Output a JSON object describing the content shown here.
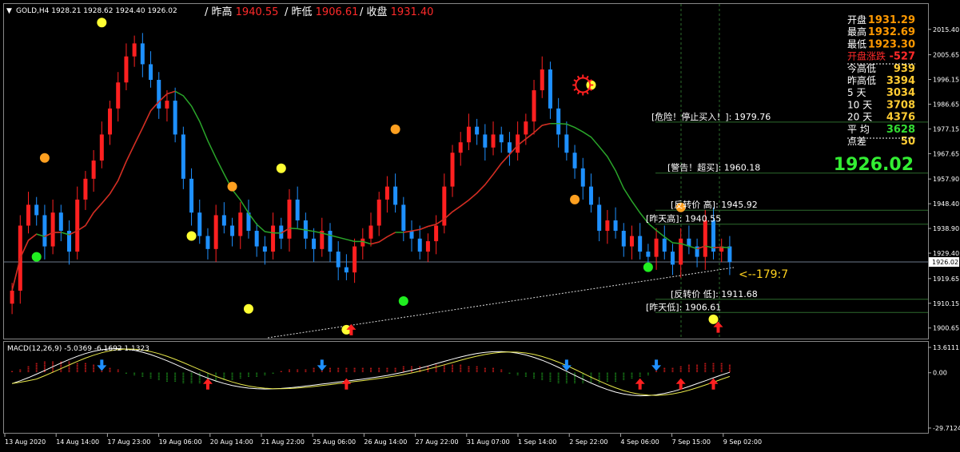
{
  "symbol_header": "GOLD,H4  1928.21 1928.62 1924.40 1926.02",
  "top_info": [
    {
      "label": "/ 昨高 ",
      "value": "1940.55"
    },
    {
      "label": "/ 昨低 ",
      "value": "1906.61"
    },
    {
      "label": "/ 收盘 ",
      "value": "1931.40"
    }
  ],
  "stats": [
    {
      "label": "开盘",
      "value": "1931.29",
      "color": "#ff9900"
    },
    {
      "label": "最高",
      "value": "1932.69",
      "color": "#ff9900"
    },
    {
      "label": "最低",
      "value": "1923.30",
      "color": "#ff9900"
    },
    {
      "label": "开盘涨跌",
      "value": "-527",
      "color": "#ff2a2a"
    },
    {
      "label": "今高低",
      "value": "939",
      "color": "#ffcc33"
    },
    {
      "label": "昨高低",
      "value": "3394",
      "color": "#ffcc33"
    },
    {
      "label": "5  天",
      "value": "3034",
      "color": "#ffcc33"
    },
    {
      "label": "10 天",
      "value": "3708",
      "color": "#ffcc33"
    },
    {
      "label": "20 天",
      "value": "4376",
      "color": "#ffcc33"
    },
    {
      "label": "平  均",
      "value": "3628",
      "color": "#33dd33"
    },
    {
      "label": "点差",
      "value": "50",
      "color": "#ffcc33"
    }
  ],
  "big_price": "1926.02",
  "level_labels": [
    {
      "text": "[危险！停止买入！]: 1979.76",
      "price": 1979.76
    },
    {
      "text": "[警告！超买]: 1960.18",
      "price": 1960.18
    },
    {
      "text": "[反转价 高]: 1945.92",
      "price": 1945.92
    },
    {
      "text": "[昨天高]: 1940.55",
      "price": 1940.55
    },
    {
      "text": "[反转价 低]: 1911.68",
      "price": 1911.68
    },
    {
      "text": "[昨天低]: 1906.61",
      "price": 1906.61
    }
  ],
  "arrow_label": "<--179:7",
  "macd_label": "MACD(12,26,9) -5.0369 -6.1692 1.1323",
  "colors": {
    "up": "#ff2020",
    "down": "#1e90ff",
    "sma": "#2aa52a",
    "sma2": "#dd2222",
    "grid": "#2d6b2d",
    "axis": "#ffffff",
    "current": "#6b7a8c",
    "dot_yellow": "#ffff33",
    "dot_orange": "#ffa020",
    "dot_green": "#20ee20"
  },
  "chart_data": {
    "type": "candlestick",
    "symbol": "GOLD",
    "timeframe": "H4",
    "ylim": [
      1897.5,
      2023
    ],
    "current_price": 1926.02,
    "y_tick_labels": [
      "2015.40",
      "2005.65",
      "1996.15",
      "1986.65",
      "1977.15",
      "1967.65",
      "1957.90",
      "1948.40",
      "1938.90",
      "1929.40",
      "1919.65",
      "1910.15",
      "1900.65"
    ],
    "x_tick_labels": [
      "13 Aug 2020",
      "14 Aug 14:00",
      "17 Aug 23:00",
      "19 Aug 06:00",
      "20 Aug 14:00",
      "21 Aug 22:00",
      "25 Aug 06:00",
      "26 Aug 14:00",
      "27 Aug 22:00",
      "31 Aug 07:00",
      "1 Sep 14:00",
      "2 Sep 22:00",
      "4 Sep 06:00",
      "7 Sep 15:00",
      "9 Sep 02:00"
    ],
    "closes": [
      1915,
      1940,
      1948,
      1944,
      1932,
      1945,
      1938,
      1930,
      1950,
      1958,
      1965,
      1975,
      1985,
      1995,
      2005,
      2010,
      2002,
      1996,
      1985,
      1988,
      1975,
      1958,
      1945,
      1936,
      1931,
      1944,
      1940,
      1936,
      1945,
      1938,
      1932,
      1930,
      1940,
      1935,
      1950,
      1942,
      1935,
      1931,
      1938,
      1930,
      1924,
      1922,
      1932,
      1935,
      1940,
      1950,
      1955,
      1948,
      1938,
      1935,
      1930,
      1934,
      1940,
      1955,
      1968,
      1972,
      1978,
      1975,
      1970,
      1975,
      1972,
      1968,
      1975,
      1980,
      1992,
      2000,
      1985,
      1975,
      1968,
      1962,
      1955,
      1948,
      1938,
      1942,
      1938,
      1932,
      1936,
      1930,
      1928,
      1935,
      1930,
      1925,
      1935,
      1932,
      1928,
      1942,
      1930,
      1932,
      1926
    ],
    "annotated_levels": [
      1979.76,
      1960.18,
      1945.92,
      1940.55,
      1911.68,
      1906.61
    ],
    "macd": {
      "params": "12,26,9",
      "main": -5.0369,
      "signal": -6.1692,
      "histogram": 1.1323,
      "ylim": [
        -29.7124,
        13.6111
      ],
      "y_tick_labels": [
        "13.6111",
        "0.00",
        "-29.7124"
      ]
    }
  }
}
